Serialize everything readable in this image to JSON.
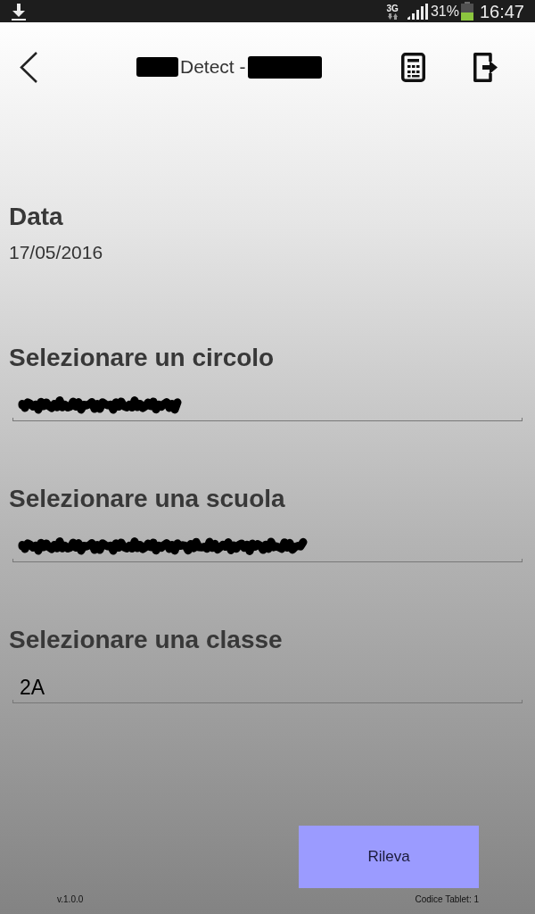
{
  "status_bar": {
    "network": "3G",
    "battery": "31%",
    "time": "16:47"
  },
  "app_bar": {
    "title_parts": [
      {
        "kind": "redacted"
      },
      {
        "kind": "text",
        "text": "Detect -"
      },
      {
        "kind": "redacted"
      }
    ]
  },
  "date": {
    "label": "Data",
    "value": "17/05/2016"
  },
  "fields": [
    {
      "label": "Selezionare un circolo",
      "kind": "redacted"
    },
    {
      "label": "Selezionare una scuola",
      "kind": "redacted"
    },
    {
      "label": "Selezionare una classe",
      "kind": "text",
      "value": "2A"
    }
  ],
  "button": {
    "label": "Rileva"
  },
  "footer": {
    "version": "v.1.0.0",
    "tablet_code": "Codice Tablet: 1"
  }
}
